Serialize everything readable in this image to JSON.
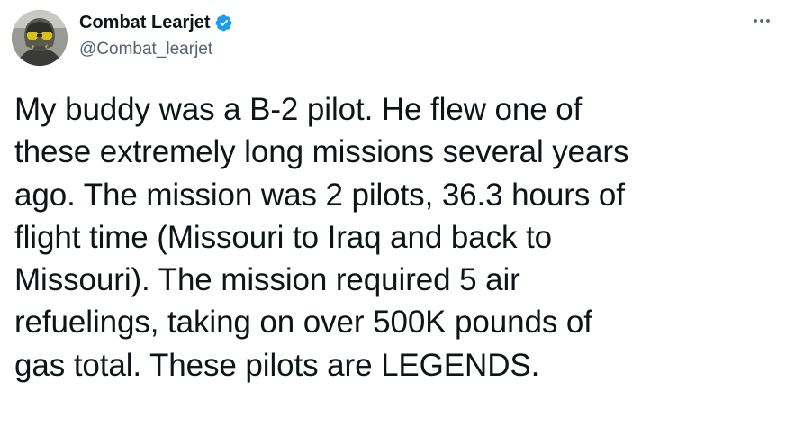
{
  "author": {
    "display_name": "Combat Learjet",
    "handle": "@Combat_learjet",
    "verified": true,
    "avatar_icon": "pilot-portrait-avatar"
  },
  "more_icon": "more-horizontal-icon",
  "tweet": {
    "text": "My buddy was a B-2 pilot. He flew one of\nthese extremely long missions several years\nago.  The mission was 2 pilots, 36.3 hours of\nflight time (Missouri to Iraq and back to\nMissouri). The mission required 5 air\nrefuelings, taking on over 500K pounds of\ngas total. These pilots are LEGENDS."
  },
  "colors": {
    "text_primary": "#0f1419",
    "text_secondary": "#536471",
    "verified_blue": "#1d9bf0"
  }
}
